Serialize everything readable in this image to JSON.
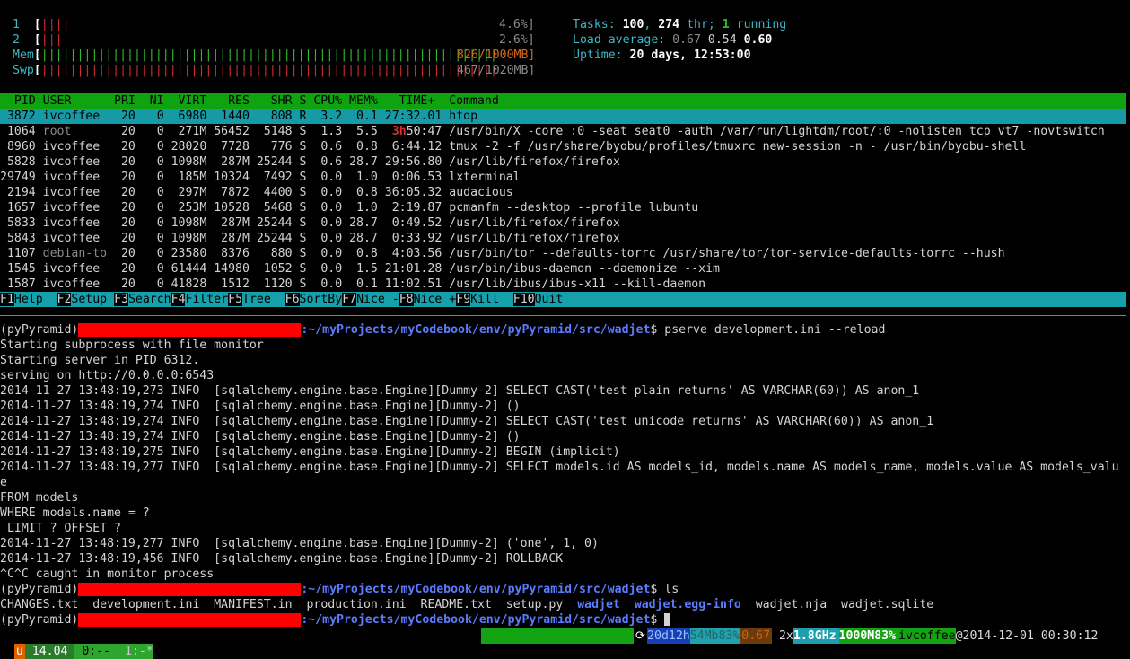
{
  "htop": {
    "meters": {
      "cpu1": {
        "label": "1",
        "bars": "||||",
        "value": "4.6%]"
      },
      "cpu2": {
        "label": "2",
        "bars": "|||",
        "value": "2.6%]"
      },
      "mem": {
        "label": "Mem",
        "value": "826/1000MB]"
      },
      "swp": {
        "label": "Swp",
        "value": "467/1020MB]"
      }
    },
    "stats": {
      "tasks_label": "Tasks: ",
      "tasks": "100",
      "tasks_sep": ", ",
      "thr": "274",
      "thr_label": " thr; ",
      "running": "1",
      "running_label": " running",
      "load_label": "Load average: ",
      "load1": "0.67",
      "load5": "0.54",
      "load15": "0.60",
      "uptime_label": "Uptime: ",
      "uptime": "20 days, 12:53:00"
    },
    "columns": "  PID USER      PRI  NI  VIRT   RES   SHR S CPU% MEM%   TIME+  Command",
    "processes": [
      {
        "pid": " 3872",
        "user": "ivcoffee ",
        "pri": "20",
        "ni": "0",
        "virt": " 6980",
        "res": " 1440",
        "shr": "  808",
        "s": "R",
        "cpu": " 3.2",
        "mem": " 0.1",
        "time": "27:32.01",
        "cmd": "htop",
        "selected": true
      },
      {
        "pid": " 1064",
        "user": "root     ",
        "pri": "20",
        "ni": "0",
        "virt": " 271M",
        "res": "56452",
        "shr": " 5148",
        "s": "S",
        "cpu": " 1.3",
        "mem": " 5.5",
        "time": "3h50:47",
        "cmd": "/usr/bin/X -core :0 -seat seat0 -auth /var/run/lightdm/root/:0 -nolisten tcp vt7 -novtswitch"
      },
      {
        "pid": " 8960",
        "user": "ivcoffee ",
        "pri": "20",
        "ni": "0",
        "virt": "28020",
        "res": " 7728",
        "shr": "  776",
        "s": "S",
        "cpu": " 0.6",
        "mem": " 0.8",
        "time": " 6:44.12",
        "cmd": "tmux -2 -f /usr/share/byobu/profiles/tmuxrc new-session -n - /usr/bin/byobu-shell"
      },
      {
        "pid": " 5828",
        "user": "ivcoffee ",
        "pri": "20",
        "ni": "0",
        "virt": "1098M",
        "res": " 287M",
        "shr": "25244",
        "s": "S",
        "cpu": " 0.6",
        "mem": "28.7",
        "time": "29:56.80",
        "cmd": "/usr/lib/firefox/firefox"
      },
      {
        "pid": "29749",
        "user": "ivcoffee ",
        "pri": "20",
        "ni": "0",
        "virt": " 185M",
        "res": "10324",
        "shr": " 7492",
        "s": "S",
        "cpu": " 0.0",
        "mem": " 1.0",
        "time": " 0:06.53",
        "cmd": "lxterminal"
      },
      {
        "pid": " 2194",
        "user": "ivcoffee ",
        "pri": "20",
        "ni": "0",
        "virt": " 297M",
        "res": " 7872",
        "shr": " 4400",
        "s": "S",
        "cpu": " 0.0",
        "mem": " 0.8",
        "time": "36:05.32",
        "cmd": "audacious"
      },
      {
        "pid": " 1657",
        "user": "ivcoffee ",
        "pri": "20",
        "ni": "0",
        "virt": " 253M",
        "res": "10528",
        "shr": " 5468",
        "s": "S",
        "cpu": " 0.0",
        "mem": " 1.0",
        "time": " 2:19.87",
        "cmd": "pcmanfm --desktop --profile lubuntu"
      },
      {
        "pid": " 5833",
        "user": "ivcoffee ",
        "pri": "20",
        "ni": "0",
        "virt": "1098M",
        "res": " 287M",
        "shr": "25244",
        "s": "S",
        "cpu": " 0.0",
        "mem": "28.7",
        "time": " 0:49.52",
        "cmd": "/usr/lib/firefox/firefox"
      },
      {
        "pid": " 5843",
        "user": "ivcoffee ",
        "pri": "20",
        "ni": "0",
        "virt": "1098M",
        "res": " 287M",
        "shr": "25244",
        "s": "S",
        "cpu": " 0.0",
        "mem": "28.7",
        "time": " 0:33.92",
        "cmd": "/usr/lib/firefox/firefox"
      },
      {
        "pid": " 1107",
        "user": "debian-to",
        "pri": "20",
        "ni": "0",
        "virt": "23580",
        "res": " 8376",
        "shr": "  880",
        "s": "S",
        "cpu": " 0.0",
        "mem": " 0.8",
        "time": " 4:03.56",
        "cmd": "/usr/bin/tor --defaults-torrc /usr/share/tor/tor-service-defaults-torrc --hush"
      },
      {
        "pid": " 1545",
        "user": "ivcoffee ",
        "pri": "20",
        "ni": "0",
        "virt": "61444",
        "res": "14980",
        "shr": " 1052",
        "s": "S",
        "cpu": " 0.0",
        "mem": " 1.5",
        "time": "21:01.28",
        "cmd": "/usr/bin/ibus-daemon --daemonize --xim"
      },
      {
        "pid": " 1587",
        "user": "ivcoffee ",
        "pri": "20",
        "ni": "0",
        "virt": "41828",
        "res": " 1512",
        "shr": " 1120",
        "s": "S",
        "cpu": " 0.0",
        "mem": " 0.1",
        "time": "11:02.51",
        "cmd": "/usr/lib/ibus/ibus-x11 --kill-daemon"
      }
    ],
    "fkeys": [
      {
        "key": "F1",
        "label": "Help  "
      },
      {
        "key": "F2",
        "label": "Setup "
      },
      {
        "key": "F3",
        "label": "Search"
      },
      {
        "key": "F4",
        "label": "Filter"
      },
      {
        "key": "F5",
        "label": "Tree  "
      },
      {
        "key": "F6",
        "label": "SortBy"
      },
      {
        "key": "F7",
        "label": "Nice -"
      },
      {
        "key": "F8",
        "label": "Nice +"
      },
      {
        "key": "F9",
        "label": "Kill  "
      },
      {
        "key": "F10",
        "label": "Quit"
      }
    ]
  },
  "shell": {
    "env": "(pyPyramid)",
    "path": ":~/myProjects/myCodebook/env/pyPyramid/src/wadjet",
    "lines": [
      {
        "type": "prompt",
        "cmd": " pserve development.ini --reload"
      },
      {
        "type": "text",
        "text": "Starting subprocess with file monitor"
      },
      {
        "type": "text",
        "text": "Starting server in PID 6312."
      },
      {
        "type": "text",
        "text": "serving on http://0.0.0.0:6543"
      },
      {
        "type": "text",
        "text": "2014-11-27 13:48:19,273 INFO  [sqlalchemy.engine.base.Engine][Dummy-2] SELECT CAST('test plain returns' AS VARCHAR(60)) AS anon_1"
      },
      {
        "type": "text",
        "text": "2014-11-27 13:48:19,274 INFO  [sqlalchemy.engine.base.Engine][Dummy-2] ()"
      },
      {
        "type": "text",
        "text": "2014-11-27 13:48:19,274 INFO  [sqlalchemy.engine.base.Engine][Dummy-2] SELECT CAST('test unicode returns' AS VARCHAR(60)) AS anon_1"
      },
      {
        "type": "text",
        "text": "2014-11-27 13:48:19,274 INFO  [sqlalchemy.engine.base.Engine][Dummy-2] ()"
      },
      {
        "type": "text",
        "text": "2014-11-27 13:48:19,275 INFO  [sqlalchemy.engine.base.Engine][Dummy-2] BEGIN (implicit)"
      },
      {
        "type": "text",
        "text": "2014-11-27 13:48:19,277 INFO  [sqlalchemy.engine.base.Engine][Dummy-2] SELECT models.id AS models_id, models.name AS models_name, models.value AS models_valu"
      },
      {
        "type": "text",
        "text": "e"
      },
      {
        "type": "text",
        "text": "FROM models"
      },
      {
        "type": "text",
        "text": "WHERE models.name = ?"
      },
      {
        "type": "text",
        "text": " LIMIT ? OFFSET ?"
      },
      {
        "type": "text",
        "text": "2014-11-27 13:48:19,277 INFO  [sqlalchemy.engine.base.Engine][Dummy-2] ('one', 1, 0)"
      },
      {
        "type": "text",
        "text": "2014-11-27 13:48:19,456 INFO  [sqlalchemy.engine.base.Engine][Dummy-2] ROLLBACK"
      },
      {
        "type": "text",
        "text": "^C^C caught in monitor process"
      },
      {
        "type": "prompt",
        "cmd": " ls"
      },
      {
        "type": "ls"
      },
      {
        "type": "prompt",
        "cmd": " ",
        "cursor": true
      }
    ],
    "ls": [
      {
        "name": "CHANGES.txt",
        "dir": false
      },
      {
        "name": "development.ini",
        "dir": false
      },
      {
        "name": "MANIFEST.in",
        "dir": false
      },
      {
        "name": "production.ini",
        "dir": false
      },
      {
        "name": "README.txt",
        "dir": false
      },
      {
        "name": "setup.py",
        "dir": false
      },
      {
        "name": "wadjet",
        "dir": true
      },
      {
        "name": "wadjet.egg-info",
        "dir": true
      },
      {
        "name": "wadjet.nja",
        "dir": false
      },
      {
        "name": "wadjet.sqlite",
        "dir": false
      }
    ]
  },
  "statusbar": {
    "distro": "u",
    "version": " 14.04 ",
    "win0": " 0:-- ",
    "win1": " 1:-*",
    "uptime": "20d12h",
    "mem": "54Mb83%",
    "load": "0.67",
    "cpu_count": " 2x",
    "cpu_freq": "1.8GHz",
    "mem2": "1000M83%",
    "user": "ivcoffee",
    "at": "@",
    "datetime": "2014-12-01 00:30:12 "
  }
}
